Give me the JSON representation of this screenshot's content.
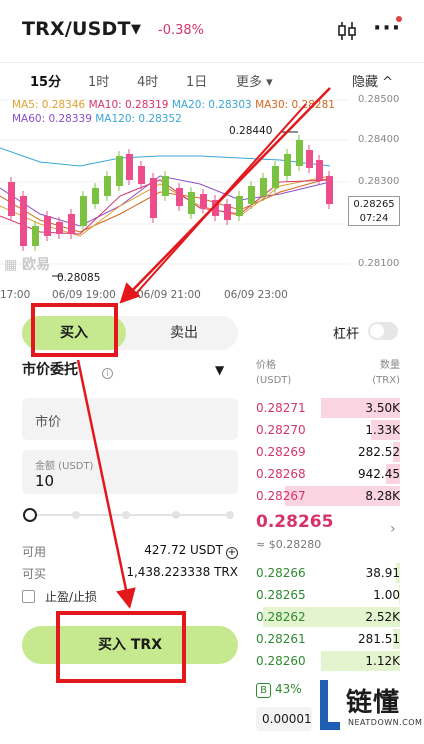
{
  "header": {
    "pair": "TRX/USDT",
    "change": "-0.38%"
  },
  "timebar": {
    "items": [
      "15分",
      "1时",
      "4时",
      "1日",
      "更多 ▾"
    ],
    "active_index": 0,
    "hide_label": "隐藏 ^"
  },
  "chart": {
    "ma_row1": [
      {
        "text": "MA5: 0.28346",
        "color": "#e0a030"
      },
      {
        "text": "MA10: 0.28319",
        "color": "#d6336c"
      },
      {
        "text": "MA20: 0.28303",
        "color": "#3aa6d8"
      },
      {
        "text": "MA30: 0.28281",
        "color": "#d4671e"
      }
    ],
    "ma_row2": [
      {
        "text": "MA60: 0.28339",
        "color": "#8a4ecb"
      },
      {
        "text": "MA120: 0.28352",
        "color": "#3aa6d8"
      }
    ],
    "price_ticks": [
      "0.28500",
      "0.28400",
      "0.28300",
      "0.28200",
      "0.28100"
    ],
    "time_ticks": [
      "17:00",
      "06/09 19:00",
      "06/09 21:00",
      "06/09 23:00"
    ],
    "current_price": "0.28265",
    "countdown": "07:24",
    "high_label": "0.28440",
    "low_label": "0.28085",
    "watermark": "欧易"
  },
  "trade": {
    "buy_tab": "买入",
    "sell_tab": "卖出",
    "leverage": "杠杆",
    "order_type": "市价委托",
    "price_placeholder": "市价",
    "amount_label": "金额 (USDT)",
    "amount_value": "10",
    "available_label": "可用",
    "available_value": "427.72 USDT",
    "can_buy_label": "可买",
    "can_buy_value": "1,438.223338 TRX",
    "tpsl_label": "止盈/止损",
    "buy_button": "买入 TRX"
  },
  "orderbook": {
    "price_header": "价格",
    "price_unit": "(USDT)",
    "qty_header": "数量",
    "qty_unit": "(TRX)",
    "asks": [
      {
        "price": "0.28271",
        "qty": "3.50K",
        "depth": 0.55
      },
      {
        "price": "0.28270",
        "qty": "1.33K",
        "depth": 0.2
      },
      {
        "price": "0.28269",
        "qty": "282.52",
        "depth": 0.05
      },
      {
        "price": "0.28268",
        "qty": "942.45",
        "depth": 0.1
      },
      {
        "price": "0.28267",
        "qty": "8.28K",
        "depth": 0.8
      }
    ],
    "mid_price": "0.28265",
    "mid_usd": "≈ $0.28280",
    "bids": [
      {
        "price": "0.28266",
        "qty": "38.91",
        "depth": 0.03
      },
      {
        "price": "0.28265",
        "qty": "1.00",
        "depth": 0.01
      },
      {
        "price": "0.28262",
        "qty": "2.52K",
        "depth": 0.95
      },
      {
        "price": "0.28261",
        "qty": "281.51",
        "depth": 0.05
      },
      {
        "price": "0.28260",
        "qty": "1.12K",
        "depth": 0.55
      }
    ],
    "ratio_badge": "B",
    "ratio_value": "43%",
    "precision": "0.00001"
  },
  "logo": {
    "text": "链懂",
    "sub": "NEATDOWN.COM"
  }
}
